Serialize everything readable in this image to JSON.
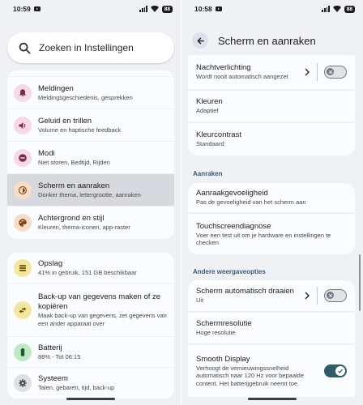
{
  "colors": {
    "notif": "#f7d8e6",
    "sound": "#f7d8e6",
    "modes": "#f7d8e6",
    "display": "#f7dcc7",
    "wallpaper": "#f7dcc7",
    "storage": "#f3e7a0",
    "backup": "#f3e7a0",
    "battery": "#bde9c6",
    "system": "#dfe0e6",
    "toggle_on": "#2c5d66"
  },
  "left": {
    "status": {
      "time": "10:59",
      "battery": "88"
    },
    "search": {
      "placeholder": "Zoeken in Instellingen",
      "icon": "search-icon"
    },
    "items": [
      {
        "icon": "bell-icon",
        "title": "Meldingen",
        "subtitle": "Meldingsgeschiedenis, gesprekken"
      },
      {
        "icon": "speaker-icon",
        "title": "Geluid en trillen",
        "subtitle": "Volume en haptische feedback"
      },
      {
        "icon": "minus-circle-icon",
        "title": "Modi",
        "subtitle": "Niet storen, Bedtijd, Rijden"
      },
      {
        "icon": "brightness-icon",
        "title": "Scherm en aanraken",
        "subtitle": "Donker thema, lettergrootte, aanraken"
      },
      {
        "icon": "palette-icon",
        "title": "Achtergrond en stijl",
        "subtitle": "Kleuren, thema-iconen, app-raster"
      },
      {
        "icon": "storage-icon",
        "title": "Opslag",
        "subtitle": "41% in gebruik, 151 GB beschikbaar"
      },
      {
        "icon": "backup-icon",
        "title": "Back-up van gegevens maken of ze kopiëren",
        "subtitle": "Maak back-up van gegevens, zet gegevens van een ander apparaat over"
      },
      {
        "icon": "battery-icon",
        "title": "Batterij",
        "subtitle": "88% - Tot 06:15"
      },
      {
        "icon": "gear-icon",
        "title": "Systeem",
        "subtitle": "Talen, gebaren, tijd, back-up"
      }
    ]
  },
  "right": {
    "status": {
      "time": "10:58",
      "battery": "88"
    },
    "title": "Scherm en aanraken",
    "items": [
      {
        "title": "Nachtverlichting",
        "subtitle": "Wordt nooit automatisch aangezet",
        "toggle": false
      },
      {
        "title": "Kleuren",
        "subtitle": "Adaptief"
      },
      {
        "title": "Kleurcontrast",
        "subtitle": "Standaard"
      }
    ],
    "section_touch": "Aanraken",
    "touch_items": [
      {
        "title": "Aanraakgevoeligheid",
        "subtitle": "Pas de gevoeligheid van het scherm aan"
      },
      {
        "title": "Touchscreendiagnose",
        "subtitle": "Voer een test uit om je hardware en instellingen te checken"
      }
    ],
    "section_other": "Andere weergaveopties",
    "other_items": [
      {
        "title": "Scherm automatisch draaien",
        "subtitle": "Uit",
        "toggle": false
      },
      {
        "title": "Schermresolutie",
        "subtitle": "Hoge resolutie"
      },
      {
        "title": "Smooth Display",
        "subtitle": "Verhoogt de vernieuwingssnelheid automatisch naar 120 Hz voor bepaalde content. Het batterijgebruik neemt toe.",
        "toggle": true
      }
    ]
  }
}
